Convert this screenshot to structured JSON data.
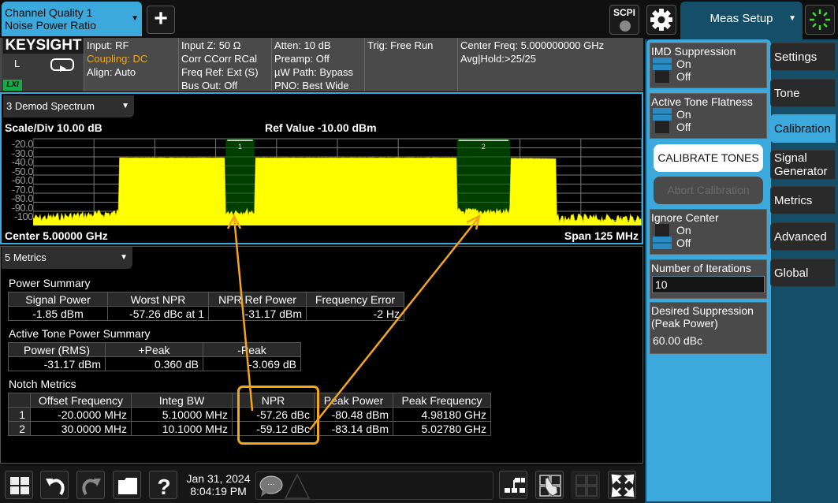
{
  "topbar": {
    "measurement_tab": {
      "line1": "Channel Quality 1",
      "line2": "Noise Power Ratio",
      "arrow": "▼"
    },
    "add_button_icon": "plus-icon",
    "scpi_label": "SCPI"
  },
  "infobar": {
    "logo": "KEYSIGHT",
    "local_indicator": "L",
    "lxi_badge": "LXI",
    "col1": [
      "Input: RF",
      "Coupling: DC",
      "Align: Auto"
    ],
    "col2": [
      "Input Z: 50 Ω",
      "Corr CCorr RCal",
      "Freq Ref: Ext (S)",
      "Bus Out: Off"
    ],
    "col3": [
      "Atten: 10 dB",
      "Preamp: Off",
      "µW Path: Bypass",
      "PNO: Best Wide"
    ],
    "col4": [
      "Trig: Free Run"
    ],
    "col5": [
      "Center Freq: 5.000000000 GHz",
      "Avg|Hold:>25/25"
    ],
    "highlight_color": "#f0a818"
  },
  "spectrum_window": {
    "dropdown_label": "3 Demod Spectrum",
    "scale_label": "Scale/Div 10.00 dB",
    "ref_label": "Ref Value -10.00 dBm",
    "center_label": "Center 5.00000 GHz",
    "span_label": "Span 125 MHz",
    "y_ticks": [
      "-20.0",
      "-30.0",
      "-40.0",
      "-50.0",
      "-60.0",
      "-70.0",
      "-80.0",
      "-90.0",
      "-100"
    ],
    "trace_color": "#ffff00",
    "notch_color": "#003f00",
    "notches": [
      {
        "label": "1",
        "offset_mhz": -20.0,
        "bw_mhz": 5.1
      },
      {
        "label": "2",
        "offset_mhz": 30.0,
        "bw_mhz": 10.1
      }
    ],
    "signal_band_mhz": [
      -45,
      45
    ],
    "signal_level_dbm": -31,
    "noise_floor_dbm": -97,
    "ref_level_dbm": -10,
    "scale_db_per_div": 10,
    "span_mhz": 125
  },
  "metrics_window": {
    "dropdown_label": "5 Metrics",
    "power_summary": {
      "title": "Power Summary",
      "headers": [
        "Signal Power",
        "Worst NPR",
        "NPR Ref Power",
        "Frequency Error"
      ],
      "row": [
        "-1.85 dBm",
        "-57.26 dBc at 1",
        "-31.17 dBm",
        "-2 Hz"
      ]
    },
    "active_tone": {
      "title": "Active Tone Power Summary",
      "headers": [
        "Power (RMS)",
        "+Peak",
        "-Peak"
      ],
      "row": [
        "-31.17 dBm",
        "0.360 dB",
        "-3.069 dB"
      ]
    },
    "notch_metrics": {
      "title": "Notch Metrics",
      "headers": [
        "",
        "Offset Frequency",
        "Integ BW",
        "NPR",
        "Peak Power",
        "Peak Frequency"
      ],
      "rows": [
        [
          "1",
          "-20.0000 MHz",
          "5.10000 MHz",
          "-57.26 dBc",
          "-80.48 dBm",
          "4.98180 GHz"
        ],
        [
          "2",
          "30.0000 MHz",
          "10.1000 MHz",
          "-59.12 dBc",
          "-83.14 dBm",
          "5.02780 GHz"
        ]
      ]
    },
    "annotation_color": "#f3a61b"
  },
  "bottombar": {
    "date": "Jan 31, 2024",
    "time": "8:04:19 PM"
  },
  "right_panel": {
    "menu_title": "Meas Setup",
    "menu_arrow": "▼",
    "imd_suppression": {
      "title": "IMD Suppression",
      "on": "On",
      "off": "Off",
      "value": "On"
    },
    "active_tone_flatness": {
      "title": "Active Tone Flatness",
      "on": "On",
      "off": "Off",
      "value": "On"
    },
    "calibrate_button": "CALIBRATE TONES",
    "abort_button": "Abort Calibration",
    "ignore_center": {
      "title": "Ignore Center",
      "on": "On",
      "off": "Off",
      "value": "Off"
    },
    "iterations": {
      "title": "Number of Iterations",
      "value": "10"
    },
    "desired_suppression": {
      "title1": "Desired Suppression",
      "title2": "(Peak Power)",
      "value": "60.00 dBc"
    },
    "menu_buttons": [
      {
        "label": "Settings"
      },
      {
        "label": "Tone"
      },
      {
        "label": "Calibration",
        "active": true
      },
      {
        "label": "Signal Generator"
      },
      {
        "label": "Metrics"
      },
      {
        "label": "Advanced"
      },
      {
        "label": "Global"
      }
    ],
    "accent_color": "#3ca9dc"
  }
}
